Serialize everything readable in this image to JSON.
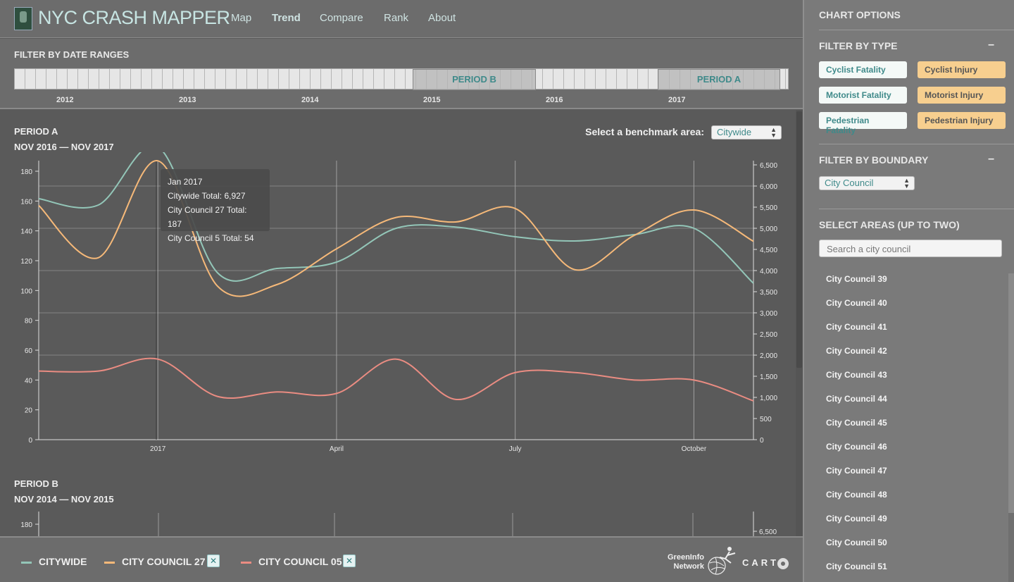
{
  "header": {
    "title": "NYC CRASH MAPPER",
    "nav": [
      {
        "label": "Map",
        "active": false
      },
      {
        "label": "Trend",
        "active": true
      },
      {
        "label": "Compare",
        "active": false
      },
      {
        "label": "Rank",
        "active": false
      },
      {
        "label": "About",
        "active": false
      }
    ]
  },
  "date_filter": {
    "heading": "FILTER BY DATE RANGES",
    "years": [
      "2012",
      "2013",
      "2014",
      "2015",
      "2016",
      "2017"
    ],
    "period_b_label": "PERIOD B",
    "period_a_label": "PERIOD A"
  },
  "period_a": {
    "title": "PERIOD A",
    "range": "NOV 2016 — NOV 2017"
  },
  "period_b": {
    "title": "PERIOD B",
    "range": "NOV 2014 — NOV 2015"
  },
  "benchmark": {
    "label": "Select a benchmark area:",
    "value": "Citywide"
  },
  "tooltip": {
    "month": "Jan 2017",
    "citywide": "Citywide Total: 6,927",
    "cc27": "City Council 27 Total: 187",
    "cc5": "City Council 5 Total: 54"
  },
  "chart_data": {
    "type": "line",
    "x": [
      "Nov 2016",
      "Dec 2016",
      "Jan 2017",
      "Feb 2017",
      "Mar 2017",
      "Apr 2017",
      "May 2017",
      "Jun 2017",
      "Jul 2017",
      "Aug 2017",
      "Sep 2017",
      "Oct 2017",
      "Nov 2017"
    ],
    "x_tick_labels": [
      "2017",
      "April",
      "July",
      "October"
    ],
    "y_left": {
      "lim": [
        0,
        180
      ],
      "ticks": [
        0,
        20,
        40,
        60,
        80,
        100,
        120,
        140,
        160,
        180
      ]
    },
    "y_right": {
      "lim": [
        0,
        6500
      ],
      "ticks": [
        "0",
        "500",
        "1,000",
        "1,500",
        "2,000",
        "2,500",
        "3,000",
        "3,500",
        "4,000",
        "4,500",
        "5,000",
        "5,500",
        "6,000",
        "6,500"
      ]
    },
    "series": [
      {
        "name": "CITYWIDE",
        "axis": "right",
        "color": "#93c6b8",
        "values": [
          5700,
          5550,
          6927,
          3950,
          4050,
          4200,
          5000,
          5030,
          4800,
          4700,
          4850,
          5000,
          3700
        ]
      },
      {
        "name": "CITY COUNCIL 27",
        "axis": "left",
        "color": "#f6b979",
        "values": [
          157,
          122,
          187,
          103,
          104,
          128,
          149,
          146,
          155,
          114,
          137,
          154,
          133
        ]
      },
      {
        "name": "CITY COUNCIL 05",
        "axis": "left",
        "color": "#ea8c82",
        "values": [
          46,
          46,
          54,
          29,
          32,
          31,
          54,
          27,
          45,
          45,
          40,
          40,
          26
        ]
      }
    ]
  },
  "period_b_chart": {
    "y_left_top": "180",
    "y_right_top": "6,500"
  },
  "legend": {
    "items": [
      {
        "label": "CITYWIDE",
        "color": "#93c6b8"
      },
      {
        "label": "CITY COUNCIL 27",
        "color": "#f6b979"
      },
      {
        "label": "CITY COUNCIL 05",
        "color": "#ea8c82"
      }
    ],
    "remove_glyph": "✕",
    "greeninfo_line1": "GreenInfo",
    "greeninfo_line2": "Network",
    "carto": "CART"
  },
  "sidebar": {
    "chart_options": "CHART OPTIONS",
    "filter_type_heading": "FILTER BY TYPE",
    "collapse_glyph": "–",
    "types": [
      {
        "label": "Cyclist Fatality",
        "kind": "fatality"
      },
      {
        "label": "Cyclist Injury",
        "kind": "injury"
      },
      {
        "label": "Motorist Fatality",
        "kind": "fatality"
      },
      {
        "label": "Motorist Injury",
        "kind": "injury"
      },
      {
        "label": "Pedestrian Fatality",
        "kind": "fatality"
      },
      {
        "label": "Pedestrian Injury",
        "kind": "injury"
      }
    ],
    "filter_boundary_heading": "FILTER BY BOUNDARY",
    "boundary_value": "City Council",
    "select_areas_heading": "SELECT AREAS (UP TO TWO)",
    "search_placeholder": "Search a city council",
    "areas": [
      "City Council 39",
      "City Council 40",
      "City Council 41",
      "City Council 42",
      "City Council 43",
      "City Council 44",
      "City Council 45",
      "City Council 46",
      "City Council 47",
      "City Council 48",
      "City Council 49",
      "City Council 50",
      "City Council 51"
    ]
  }
}
